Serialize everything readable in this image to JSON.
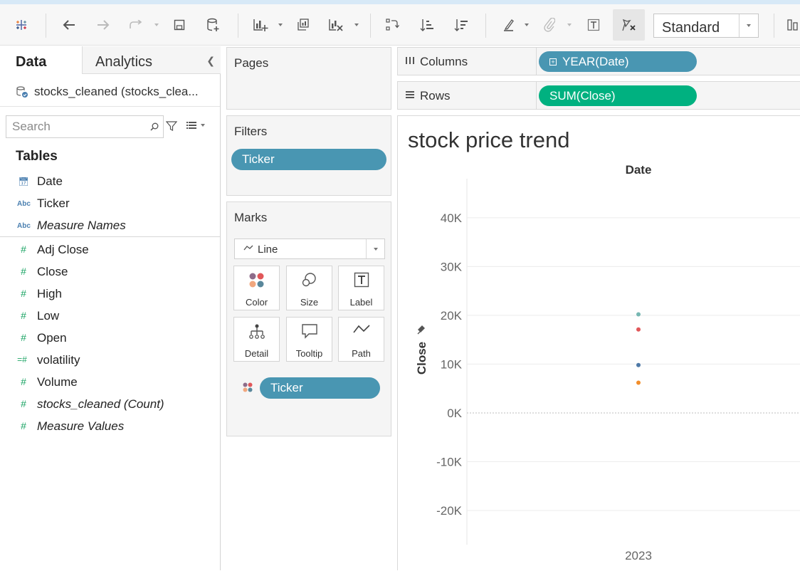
{
  "toolbar": {
    "fit_value": "Standard"
  },
  "datapane": {
    "tab_data": "Data",
    "tab_analytics": "Analytics",
    "datasource": "stocks_cleaned (stocks_clea...",
    "search_placeholder": "Search",
    "tables_heading": "Tables",
    "dimensions": [
      {
        "name": "Date",
        "icon": "calendar-icon"
      },
      {
        "name": "Ticker",
        "icon": "abc-icon"
      },
      {
        "name": "Measure Names",
        "icon": "abc-icon"
      }
    ],
    "measures": [
      {
        "name": "Adj Close",
        "icon": "hash-icon"
      },
      {
        "name": "Close",
        "icon": "hash-icon"
      },
      {
        "name": "High",
        "icon": "hash-icon"
      },
      {
        "name": "Low",
        "icon": "hash-icon"
      },
      {
        "name": "Open",
        "icon": "hash-icon"
      },
      {
        "name": "volatility",
        "icon": "calc-hash-icon"
      },
      {
        "name": "Volume",
        "icon": "hash-icon"
      },
      {
        "name": "stocks_cleaned (Count)",
        "icon": "hash-icon"
      },
      {
        "name": "Measure Values",
        "icon": "hash-icon"
      }
    ]
  },
  "cards": {
    "pages_title": "Pages",
    "filters_title": "Filters",
    "filter_pill": "Ticker",
    "marks_title": "Marks",
    "mark_type": "Line",
    "mark_buttons": {
      "color": "Color",
      "size": "Size",
      "label": "Label",
      "detail": "Detail",
      "tooltip": "Tooltip",
      "path": "Path"
    },
    "color_pill": "Ticker"
  },
  "shelves": {
    "columns_label": "Columns",
    "columns_pill": "YEAR(Date)",
    "rows_label": "Rows",
    "rows_pill": "SUM(Close)"
  },
  "view": {
    "title": "stock price trend"
  },
  "chart_data": {
    "type": "scatter",
    "title": "stock price trend",
    "xlabel": "Date",
    "ylabel": "Close",
    "categories": [
      "2023"
    ],
    "yticks": [
      "40K",
      "30K",
      "20K",
      "10K",
      "0K",
      "-10K",
      "-20K"
    ],
    "ylim": [
      -27000,
      48000
    ],
    "grid": true,
    "series": [
      {
        "values": [
          20200
        ],
        "color": "#76b7b2"
      },
      {
        "values": [
          17100
        ],
        "color": "#e15759"
      },
      {
        "values": [
          9800
        ],
        "color": "#4e79a7"
      },
      {
        "values": [
          6200
        ],
        "color": "#f28e2b"
      }
    ]
  }
}
